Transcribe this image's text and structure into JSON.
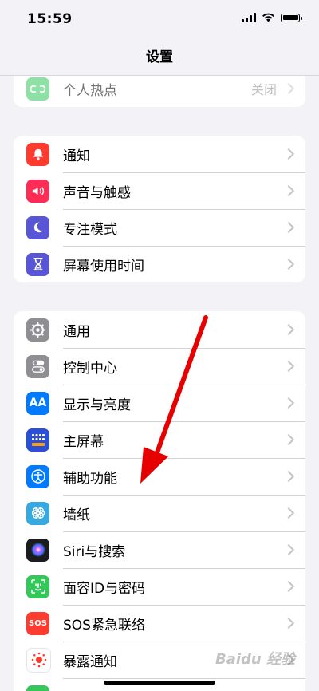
{
  "status_bar": {
    "time": "15:59"
  },
  "nav": {
    "title": "设置"
  },
  "group0": [
    {
      "label": "个人热点",
      "value": "关闭",
      "icon": "hotspot-icon",
      "color": "#34c759"
    }
  ],
  "group1": [
    {
      "label": "通知",
      "icon": "bell-icon",
      "color": "#ff3b30"
    },
    {
      "label": "声音与触感",
      "icon": "speaker-icon",
      "color": "#ff2d55"
    },
    {
      "label": "专注模式",
      "icon": "moon-icon",
      "color": "#5856d6"
    },
    {
      "label": "屏幕使用时间",
      "icon": "hourglass-icon",
      "color": "#5856d6"
    }
  ],
  "group2": [
    {
      "label": "通用",
      "icon": "gear-icon",
      "color": "#8e8e93"
    },
    {
      "label": "控制中心",
      "icon": "toggles-icon",
      "color": "#8e8e93"
    },
    {
      "label": "显示与亮度",
      "icon": "text-size-icon",
      "color": "#007aff",
      "glyph": "AA"
    },
    {
      "label": "主屏幕",
      "icon": "home-grid-icon",
      "color": "#2c4fd8"
    },
    {
      "label": "辅助功能",
      "icon": "accessibility-icon",
      "color": "#007aff"
    },
    {
      "label": "墙纸",
      "icon": "flower-icon",
      "color": "#36a9e1"
    },
    {
      "label": "Siri与搜索",
      "icon": "siri-icon",
      "color": "#1c1c1e"
    },
    {
      "label": "面容ID与密码",
      "icon": "face-id-icon",
      "color": "#34c759"
    },
    {
      "label": "SOS紧急联络",
      "icon": "sos-icon",
      "color": "#ff3b30",
      "glyph": "SOS"
    },
    {
      "label": "暴露通知",
      "icon": "exposure-icon",
      "color": "#ffffff"
    }
  ],
  "watermark": "Baidu 经验"
}
